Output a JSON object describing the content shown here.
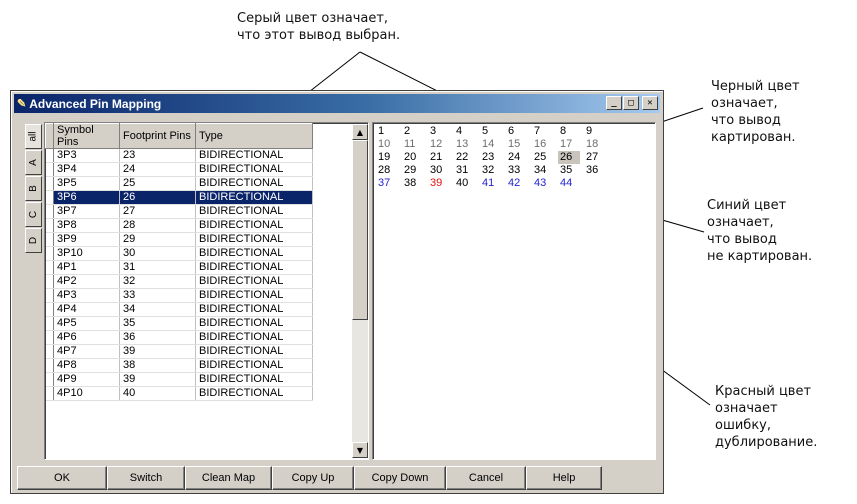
{
  "callouts": {
    "gray": "Серый цвет означает,\nчто этот вывод выбран.",
    "black": "Черный цвет\nозначает,\nчто вывод\nкартирован.",
    "blue": "Синий цвет\nозначает,\nчто вывод\nне картирован.",
    "red": "Красный цвет\nозначает\nошибку,\nдублирование."
  },
  "window": {
    "title": "Advanced Pin Mapping",
    "minimize": "_",
    "maximize": "□",
    "close": "✕"
  },
  "tabs": [
    "all",
    "A",
    "B",
    "C",
    "D"
  ],
  "table": {
    "headers": [
      "Symbol Pins",
      "Footprint Pins",
      "Type"
    ],
    "selected_index": 3,
    "rows": [
      [
        "3P3",
        "23",
        "BIDIRECTIONAL"
      ],
      [
        "3P4",
        "24",
        "BIDIRECTIONAL"
      ],
      [
        "3P5",
        "25",
        "BIDIRECTIONAL"
      ],
      [
        "3P6",
        "26",
        "BIDIRECTIONAL"
      ],
      [
        "3P7",
        "27",
        "BIDIRECTIONAL"
      ],
      [
        "3P8",
        "28",
        "BIDIRECTIONAL"
      ],
      [
        "3P9",
        "29",
        "BIDIRECTIONAL"
      ],
      [
        "3P10",
        "30",
        "BIDIRECTIONAL"
      ],
      [
        "4P1",
        "31",
        "BIDIRECTIONAL"
      ],
      [
        "4P2",
        "32",
        "BIDIRECTIONAL"
      ],
      [
        "4P3",
        "33",
        "BIDIRECTIONAL"
      ],
      [
        "4P4",
        "34",
        "BIDIRECTIONAL"
      ],
      [
        "4P5",
        "35",
        "BIDIRECTIONAL"
      ],
      [
        "4P6",
        "36",
        "BIDIRECTIONAL"
      ],
      [
        "4P7",
        "39",
        "BIDIRECTIONAL"
      ],
      [
        "4P8",
        "38",
        "BIDIRECTIONAL"
      ],
      [
        "4P9",
        "39",
        "BIDIRECTIONAL"
      ],
      [
        "4P10",
        "40",
        "BIDIRECTIONAL"
      ]
    ]
  },
  "pin_map": {
    "columns": 9,
    "pins": [
      {
        "n": "1",
        "s": "mapped"
      },
      {
        "n": "2",
        "s": "mapped"
      },
      {
        "n": "3",
        "s": "mapped"
      },
      {
        "n": "4",
        "s": "mapped"
      },
      {
        "n": "5",
        "s": "mapped"
      },
      {
        "n": "6",
        "s": "mapped"
      },
      {
        "n": "7",
        "s": "mapped"
      },
      {
        "n": "8",
        "s": "mapped"
      },
      {
        "n": "9",
        "s": "mapped"
      },
      {
        "n": "10",
        "s": "unused"
      },
      {
        "n": "11",
        "s": "unused"
      },
      {
        "n": "12",
        "s": "unused"
      },
      {
        "n": "13",
        "s": "unused"
      },
      {
        "n": "14",
        "s": "unused"
      },
      {
        "n": "15",
        "s": "unused"
      },
      {
        "n": "16",
        "s": "unused"
      },
      {
        "n": "17",
        "s": "unused"
      },
      {
        "n": "18",
        "s": "unused"
      },
      {
        "n": "19",
        "s": "mapped"
      },
      {
        "n": "20",
        "s": "mapped"
      },
      {
        "n": "21",
        "s": "mapped"
      },
      {
        "n": "22",
        "s": "mapped"
      },
      {
        "n": "23",
        "s": "mapped"
      },
      {
        "n": "24",
        "s": "mapped"
      },
      {
        "n": "25",
        "s": "mapped"
      },
      {
        "n": "26",
        "s": "selected"
      },
      {
        "n": "27",
        "s": "mapped"
      },
      {
        "n": "28",
        "s": "mapped"
      },
      {
        "n": "29",
        "s": "mapped"
      },
      {
        "n": "30",
        "s": "mapped"
      },
      {
        "n": "31",
        "s": "mapped"
      },
      {
        "n": "32",
        "s": "mapped"
      },
      {
        "n": "33",
        "s": "mapped"
      },
      {
        "n": "34",
        "s": "mapped"
      },
      {
        "n": "35",
        "s": "mapped"
      },
      {
        "n": "36",
        "s": "mapped"
      },
      {
        "n": "37",
        "s": "unmapped"
      },
      {
        "n": "38",
        "s": "mapped"
      },
      {
        "n": "39",
        "s": "error"
      },
      {
        "n": "40",
        "s": "mapped"
      },
      {
        "n": "41",
        "s": "unmapped"
      },
      {
        "n": "42",
        "s": "unmapped"
      },
      {
        "n": "43",
        "s": "unmapped"
      },
      {
        "n": "44",
        "s": "unmapped"
      }
    ],
    "colors": {
      "mapped": "#000000",
      "unused": "#6e6e6e",
      "unmapped": "#1f1fd0",
      "error": "#e01010",
      "selected_bg": "#c8c4bc"
    }
  },
  "buttons": [
    "OK",
    "Switch",
    "Clean Map",
    "Copy Up",
    "Copy Down",
    "Cancel",
    "Help"
  ]
}
